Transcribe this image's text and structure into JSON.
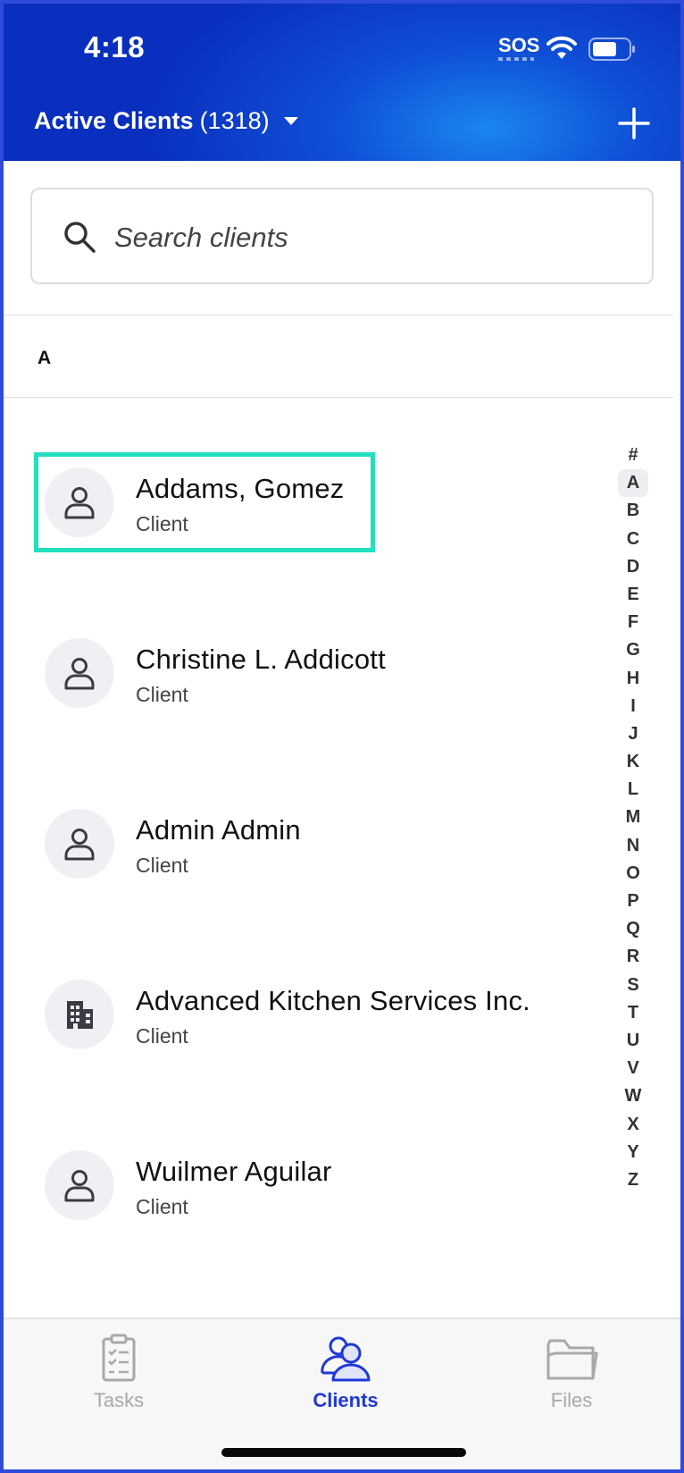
{
  "status_bar": {
    "time": "4:18",
    "sos": "SOS",
    "wifi_icon": "wifi-icon",
    "battery_icon": "battery-icon"
  },
  "header": {
    "title": "Active Clients",
    "count": "(1318)",
    "dropdown_icon": "caret-down-icon",
    "add_icon": "plus-icon"
  },
  "search": {
    "placeholder": "Search clients",
    "value": "",
    "icon": "search-icon"
  },
  "section": {
    "letter": "A"
  },
  "clients": [
    {
      "name": "Addams, Gomez",
      "type": "Client",
      "icon": "person-icon",
      "highlighted": true
    },
    {
      "name": "Christine L. Addicott",
      "type": "Client",
      "icon": "person-icon"
    },
    {
      "name": "Admin Admin",
      "type": "Client",
      "icon": "person-icon"
    },
    {
      "name": "Advanced Kitchen Services Inc.",
      "type": "Client",
      "icon": "building-icon"
    },
    {
      "name": "Wuilmer Aguilar",
      "type": "Client",
      "icon": "person-icon"
    }
  ],
  "alphabet_index": {
    "letters": [
      "#",
      "A",
      "B",
      "C",
      "D",
      "E",
      "F",
      "G",
      "H",
      "I",
      "J",
      "K",
      "L",
      "M",
      "N",
      "O",
      "P",
      "Q",
      "R",
      "S",
      "T",
      "U",
      "V",
      "W",
      "X",
      "Y",
      "Z"
    ],
    "active": "A"
  },
  "tabs": [
    {
      "label": "Tasks",
      "icon": "clipboard-icon",
      "active": false
    },
    {
      "label": "Clients",
      "icon": "people-icon",
      "active": true
    },
    {
      "label": "Files",
      "icon": "folder-icon",
      "active": false
    }
  ],
  "colors": {
    "header_dark": "#0a2fbf",
    "header_light": "#1a86f0",
    "accent": "#1f39d6",
    "highlight": "#22dfc0"
  }
}
